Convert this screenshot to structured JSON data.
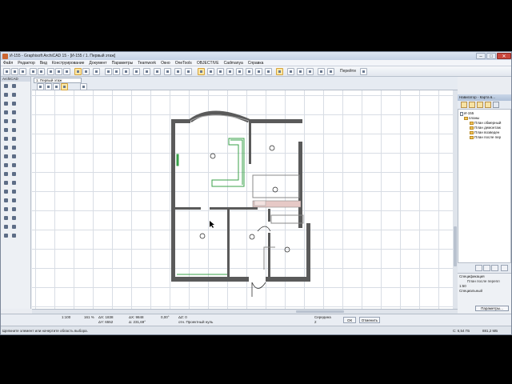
{
  "window": {
    "title": "И-155 - Graphisoft ArchiCAD 15 - [И-155 / 1. Первый этаж]",
    "minimize": "–",
    "maximize": "□",
    "close": "✕"
  },
  "menu": [
    "Файл",
    "Редактор",
    "Вид",
    "Конструирование",
    "Документ",
    "Параметры",
    "Teamwork",
    "Окно",
    "OneTools",
    "OBJECTIVE",
    "Cadmanya",
    "Справка"
  ],
  "toolbar": {
    "goto_label": "Перейти"
  },
  "toolbox": {
    "header": "ArchiCAD"
  },
  "tab": {
    "label": "1. Первый этаж"
  },
  "navigator": {
    "header": "Навигатор - Карта в...",
    "tree": [
      "И-155",
      "планы",
      "План обмерный",
      "План демонтаж",
      "План возведен",
      "План после пер"
    ],
    "prop_label": "Спецификация",
    "prop_value": "План после перепл",
    "scale_value": "1:50",
    "special_label": "Специальный",
    "params_button": "Параметры..."
  },
  "info": {
    "scale": "1:100",
    "zoom": "161 %",
    "angle": "0,00°",
    "ax": "ΔX: 1838",
    "ay": "ΔY: 6552",
    "bx": "ΔX: 9848",
    "by": "Δ: 231,69°",
    "ez": "ΔZ: 0",
    "ref": "отн. Проектный нуль",
    "center": "Середина",
    "count": "2",
    "ok": "ОК",
    "cancel": "Отменить"
  },
  "status": {
    "message": "Щелкните элемент или начертите область выбора.",
    "disk": "C: 6,54 ГБ",
    "mem": "881,2 МБ"
  },
  "colors": {
    "wall": "#5a5a5a",
    "selected": "#3aa04a",
    "accent": "#c9463d"
  }
}
